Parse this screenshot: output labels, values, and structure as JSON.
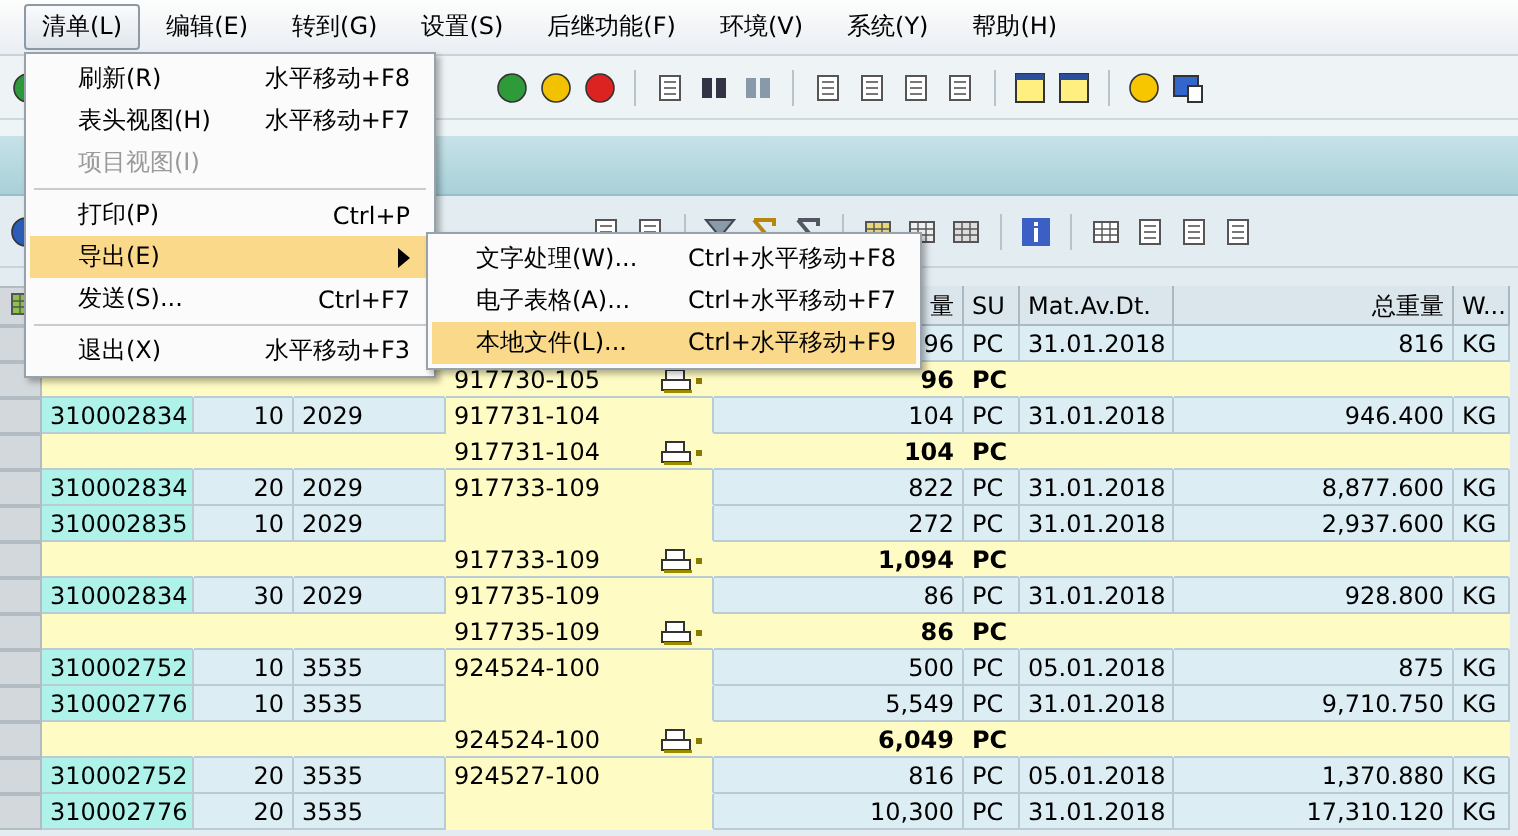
{
  "menubar": [
    {
      "label": "清单(L)",
      "selected": true
    },
    {
      "label": "编辑(E)",
      "selected": false
    },
    {
      "label": "转到(G)",
      "selected": false
    },
    {
      "label": "设置(S)",
      "selected": false
    },
    {
      "label": "后继功能(F)",
      "selected": false
    },
    {
      "label": "环境(V)",
      "selected": false
    },
    {
      "label": "系统(Y)",
      "selected": false
    },
    {
      "label": "帮助(H)",
      "selected": false
    }
  ],
  "dropdown": {
    "groups": [
      [
        {
          "label": "刷新(R)",
          "shortcut": "水平移动+F8",
          "disabled": false,
          "selected": false,
          "has_submenu": false
        },
        {
          "label": "表头视图(H)",
          "shortcut": "水平移动+F7",
          "disabled": false,
          "selected": false,
          "has_submenu": false
        },
        {
          "label": "项目视图(I)",
          "disabled": true,
          "selected": false,
          "has_submenu": false
        }
      ],
      [
        {
          "label": "打印(P)",
          "shortcut": "Ctrl+P",
          "disabled": false,
          "selected": false,
          "has_submenu": false
        },
        {
          "label": "导出(E)",
          "disabled": false,
          "selected": true,
          "has_submenu": true
        },
        {
          "label": "发送(S)...",
          "shortcut": "Ctrl+F7",
          "disabled": false,
          "selected": false,
          "has_submenu": false
        }
      ],
      [
        {
          "label": "退出(X)",
          "shortcut": "水平移动+F3",
          "disabled": false,
          "selected": false,
          "has_submenu": false
        }
      ]
    ]
  },
  "submenu": {
    "items": [
      {
        "label": "文字处理(W)...",
        "shortcut": "Ctrl+水平移动+F8",
        "selected": false
      },
      {
        "label": "电子表格(A)...",
        "shortcut": "Ctrl+水平移动+F7",
        "selected": false
      },
      {
        "label": "本地文件(L)...",
        "shortcut": "Ctrl+水平移动+F9",
        "selected": true
      }
    ]
  },
  "table": {
    "columns": [
      {
        "label": "量"
      },
      {
        "label": "SU"
      },
      {
        "label": "Mat.Av.Dt."
      },
      {
        "label": "总重量"
      },
      {
        "label": "W..."
      }
    ],
    "rows": [
      {
        "kind": "item",
        "qty": "96",
        "su": "PC",
        "date": "31.01.2018",
        "weight": "816",
        "unit": "KG"
      },
      {
        "kind": "subtotal",
        "material": "917730-105",
        "qty": "96",
        "su": "PC"
      },
      {
        "kind": "item",
        "doc": "310002834",
        "item": "10",
        "plant": "2029",
        "material": "917731-104",
        "qty": "104",
        "su": "PC",
        "date": "31.01.2018",
        "weight": "946.400",
        "unit": "KG"
      },
      {
        "kind": "subtotal",
        "material": "917731-104",
        "qty": "104",
        "su": "PC"
      },
      {
        "kind": "item",
        "doc": "310002834",
        "item": "20",
        "plant": "2029",
        "material": "917733-109",
        "qty": "822",
        "su": "PC",
        "date": "31.01.2018",
        "weight": "8,877.600",
        "unit": "KG"
      },
      {
        "kind": "item",
        "doc": "310002835",
        "item": "10",
        "plant": "2029",
        "qty": "272",
        "su": "PC",
        "date": "31.01.2018",
        "weight": "2,937.600",
        "unit": "KG"
      },
      {
        "kind": "subtotal",
        "material": "917733-109",
        "qty": "1,094",
        "su": "PC"
      },
      {
        "kind": "item",
        "doc": "310002834",
        "item": "30",
        "plant": "2029",
        "material": "917735-109",
        "qty": "86",
        "su": "PC",
        "date": "31.01.2018",
        "weight": "928.800",
        "unit": "KG"
      },
      {
        "kind": "subtotal",
        "material": "917735-109",
        "qty": "86",
        "su": "PC"
      },
      {
        "kind": "item",
        "doc": "310002752",
        "item": "10",
        "plant": "3535",
        "material": "924524-100",
        "qty": "500",
        "su": "PC",
        "date": "05.01.2018",
        "weight": "875",
        "unit": "KG"
      },
      {
        "kind": "item",
        "doc": "310002776",
        "item": "10",
        "plant": "3535",
        "qty": "5,549",
        "su": "PC",
        "date": "31.01.2018",
        "weight": "9,710.750",
        "unit": "KG"
      },
      {
        "kind": "subtotal",
        "material": "924524-100",
        "qty": "6,049",
        "su": "PC"
      },
      {
        "kind": "item",
        "doc": "310002752",
        "item": "20",
        "plant": "3535",
        "material": "924527-100",
        "qty": "816",
        "su": "PC",
        "date": "05.01.2018",
        "weight": "1,370.880",
        "unit": "KG"
      },
      {
        "kind": "item",
        "doc": "310002776",
        "item": "20",
        "plant": "3535",
        "qty": "10,300",
        "su": "PC",
        "date": "31.01.2018",
        "weight": "17,310.120",
        "unit": "KG"
      }
    ]
  }
}
